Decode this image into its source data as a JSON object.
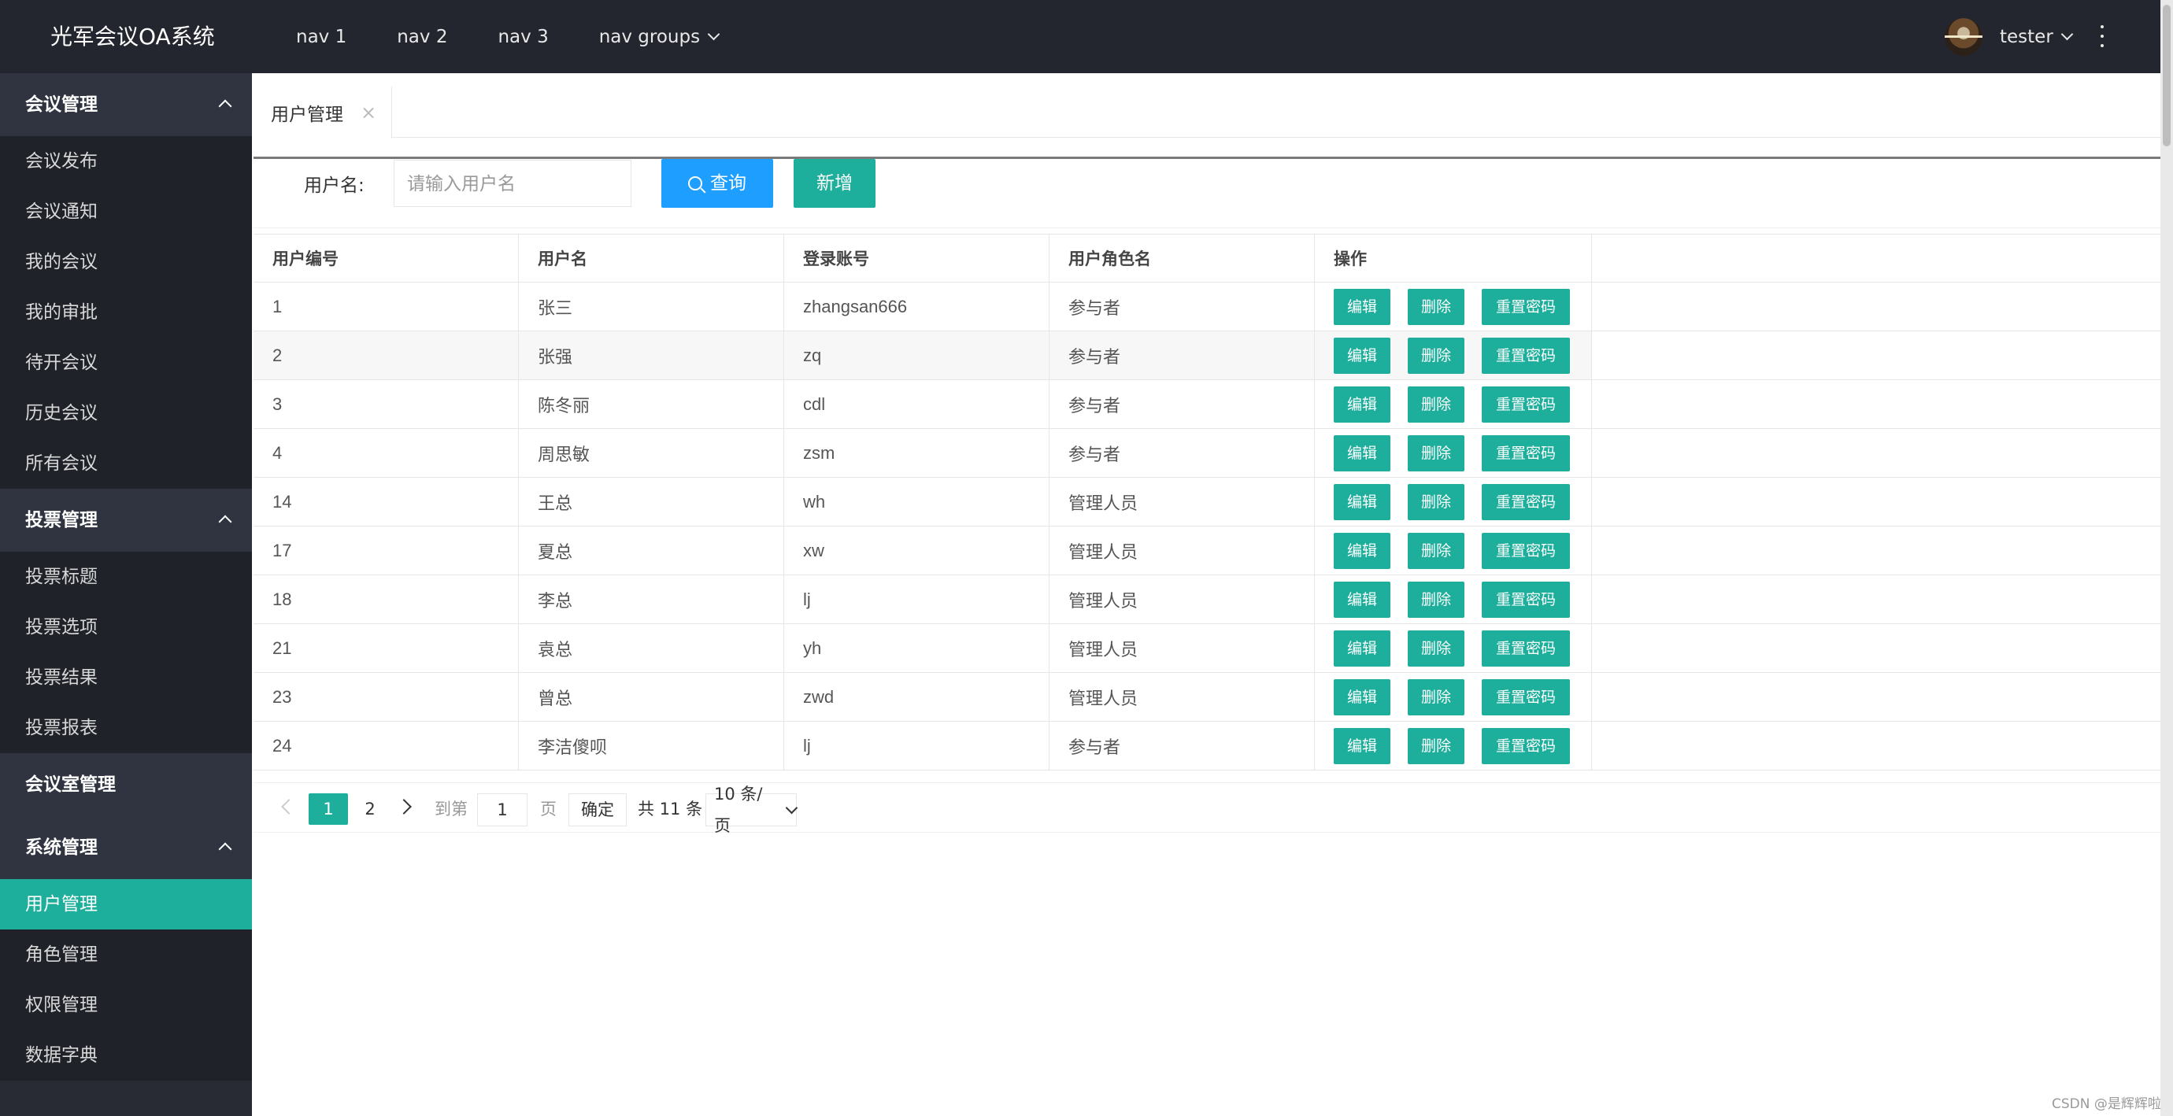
{
  "app": {
    "title": "光军会议OA系统"
  },
  "topnav": {
    "items": [
      "nav 1",
      "nav 2",
      "nav 3",
      "nav groups"
    ],
    "user": "tester"
  },
  "sidebar": {
    "groups": [
      {
        "title": "会议管理",
        "items": [
          "会议发布",
          "会议通知",
          "我的会议",
          "我的审批",
          "待开会议",
          "历史会议",
          "所有会议"
        ]
      },
      {
        "title": "投票管理",
        "items": [
          "投票标题",
          "投票选项",
          "投票结果",
          "投票报表"
        ]
      },
      {
        "title": "会议室管理",
        "items": []
      },
      {
        "title": "系统管理",
        "items": [
          "用户管理",
          "角色管理",
          "权限管理",
          "数据字典"
        ]
      }
    ],
    "active_item": "用户管理"
  },
  "tabs": [
    {
      "label": "用户管理",
      "close": "×"
    }
  ],
  "search": {
    "label": "用户名:",
    "placeholder": "请输入用户名",
    "query_label": "查询",
    "add_label": "新增"
  },
  "table": {
    "headers": [
      "用户编号",
      "用户名",
      "登录账号",
      "用户角色名",
      "操作"
    ],
    "rows": [
      [
        "1",
        "张三",
        "zhangsan666",
        "参与者"
      ],
      [
        "2",
        "张强",
        "zq",
        "参与者"
      ],
      [
        "3",
        "陈冬丽",
        "cdl",
        "参与者"
      ],
      [
        "4",
        "周思敏",
        "zsm",
        "参与者"
      ],
      [
        "14",
        "王总",
        "wh",
        "管理人员"
      ],
      [
        "17",
        "夏总",
        "xw",
        "管理人员"
      ],
      [
        "18",
        "李总",
        "lj",
        "管理人员"
      ],
      [
        "21",
        "袁总",
        "yh",
        "管理人员"
      ],
      [
        "23",
        "曾总",
        "zwd",
        "管理人员"
      ],
      [
        "24",
        "李洁傻呗",
        "lj",
        "参与者"
      ]
    ],
    "actions": {
      "edit": "编辑",
      "delete": "删除",
      "reset": "重置密码"
    }
  },
  "pagination": {
    "pages": [
      "1",
      "2"
    ],
    "current": "1",
    "goto_label": "到第",
    "goto_value": "1",
    "page_label": "页",
    "confirm_label": "确定",
    "total_label": "共 11 条",
    "page_size_label": "10 条/页"
  },
  "watermark": "CSDN @是辉辉啦",
  "colors": {
    "accent": "#1eaf9c",
    "query": "#1e9fff",
    "header_bg": "#23262e",
    "sidebar_bg": "#282b33"
  }
}
